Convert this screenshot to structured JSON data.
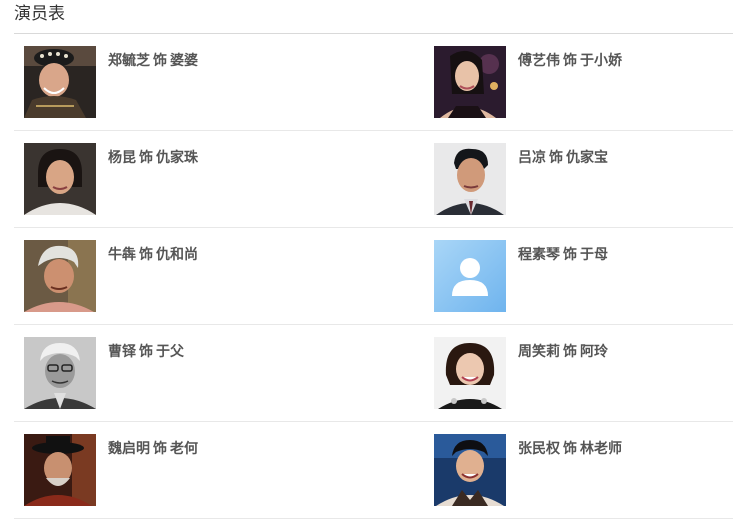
{
  "section": {
    "title": "演员表"
  },
  "cast": [
    {
      "actor": "郑毓芝",
      "role_word": "饰",
      "role": "婆婆",
      "photo": "elderly-woman-headdress"
    },
    {
      "actor": "傅艺伟",
      "role_word": "饰",
      "role": "于小娇",
      "photo": "woman-dark-hair"
    },
    {
      "actor": "杨昆",
      "role_word": "饰",
      "role": "仇家珠",
      "photo": "woman-short-hair"
    },
    {
      "actor": "吕凉",
      "role_word": "饰",
      "role": "仇家宝",
      "photo": "man-suit"
    },
    {
      "actor": "牛犇",
      "role_word": "饰",
      "role": "仇和尚",
      "photo": "elderly-man-white-hair"
    },
    {
      "actor": "程素琴",
      "role_word": "饰",
      "role": "于母",
      "photo": "default-avatar-icon"
    },
    {
      "actor": "曹铎",
      "role_word": "饰",
      "role": "于父",
      "photo": "elderly-man-glasses-bw"
    },
    {
      "actor": "周笑莉",
      "role_word": "饰",
      "role": "阿玲",
      "photo": "woman-smiling"
    },
    {
      "actor": "魏启明",
      "role_word": "饰",
      "role": "老何",
      "photo": "man-hat-costume"
    },
    {
      "actor": "张民权",
      "role_word": "饰",
      "role": "林老师",
      "photo": "man-smiling"
    }
  ],
  "colors": {
    "name_text": "#555555",
    "divider": "#e8e8e8",
    "avatar_bg": "#8ec5f2"
  }
}
